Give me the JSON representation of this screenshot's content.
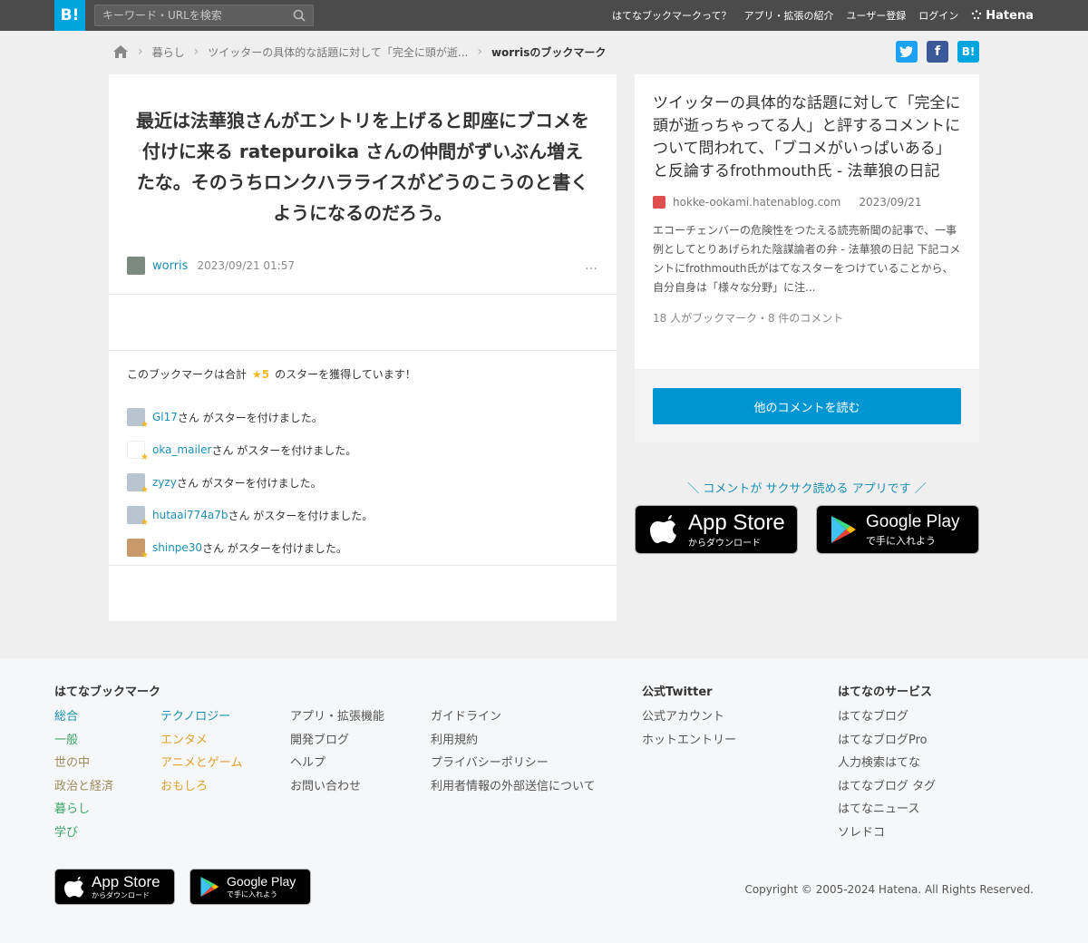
{
  "header": {
    "logo": "B!",
    "search_placeholder": "キーワード・URLを検索",
    "nav": [
      "はてなブックマークって？",
      "アプリ・拡張の紹介",
      "ユーザー登録",
      "ログイン"
    ],
    "hatena": "Hatena"
  },
  "breadcrumb": {
    "items": [
      "暮らし",
      "ツイッターの具体的な話題に対して「完全に頭が逝...",
      "worrisのブックマーク"
    ]
  },
  "share": [
    "twitter",
    "facebook",
    "B!"
  ],
  "comment": {
    "text": "最近は法華狼さんがエントリを上げると即座にブコメを付けに来る ratepuroika さんの仲間がずいぶん増えたな。そのうちロンクハラライスがどうのこうのと書くようになるのだろう。",
    "user": "worris",
    "date": "2023/09/21 01:57",
    "more": "…"
  },
  "stars": {
    "summary_prefix": "このブックマークは合計",
    "count": "★5",
    "summary_suffix": "のスターを獲得しています！",
    "suffix": "さん がスターを付けました。",
    "users": [
      "Gl17",
      "oka_mailer",
      "zyzy",
      "hutaai774a7b",
      "shinpe30"
    ]
  },
  "entry": {
    "title": "ツイッターの具体的な話題に対して「完全に頭が逝っちゃってる人」と評するコメントについて問われて、「ブコメがいっぱいある」と反論するfrothmouth氏 - 法華狼の日記",
    "source": "hokke-ookami.hatenablog.com",
    "date": "2023/09/21",
    "description": "エコーチェンバーの危険性をつたえる読売新聞の記事で、一事例としてとりあげられた陰謀論者の弁 - 法華狼の日記 下記コメントにfrothmouth氏がはてなスターをつけていることから、自分自身は「様々な分野」に注...",
    "counts": "18 人がブックマーク・8 件のコメント",
    "read_more": "他のコメントを読む"
  },
  "promo": "＼ コメントが サクサク読める アプリです ／",
  "badges": {
    "appstore_title": "App Store",
    "appstore_sub": "からダウンロード",
    "googleplay_title": "Google Play",
    "googleplay_sub": "で手に入れよう"
  },
  "footer": {
    "bookmark_heading": "はてなブックマーク",
    "categories1": [
      "総合",
      "一般",
      "世の中",
      "政治と経済",
      "暮らし",
      "学び"
    ],
    "categories2": [
      "テクノロジー",
      "エンタメ",
      "アニメとゲーム",
      "おもしろ"
    ],
    "links1": [
      "アプリ・拡張機能",
      "開発ブログ",
      "ヘルプ",
      "お問い合わせ"
    ],
    "links2": [
      "ガイドライン",
      "利用規約",
      "プライバシーポリシー",
      "利用者情報の外部送信について"
    ],
    "twitter_heading": "公式Twitter",
    "twitter_links": [
      "公式アカウント",
      "ホットエントリー"
    ],
    "services_heading": "はてなのサービス",
    "services": [
      "はてなブログ",
      "はてなブログPro",
      "人力検索はてな",
      "はてなブログ タグ",
      "はてなニュース",
      "ソレドコ"
    ],
    "copyright": "Copyright © 2005-2024 Hatena. All Rights Reserved."
  },
  "colors": {
    "brand": "#00a4de",
    "link": "#1a8fb5",
    "star": "#f5b520",
    "button": "#0096d3",
    "cat_colors": [
      "#1a8fb5",
      "#3aa56a",
      "#9b8a5a",
      "#9b8a5a",
      "#3aa56a",
      "#3aa56a"
    ],
    "cat2_colors": [
      "#1a8fb5",
      "#e0a030",
      "#e0a030",
      "#e0a030"
    ]
  }
}
